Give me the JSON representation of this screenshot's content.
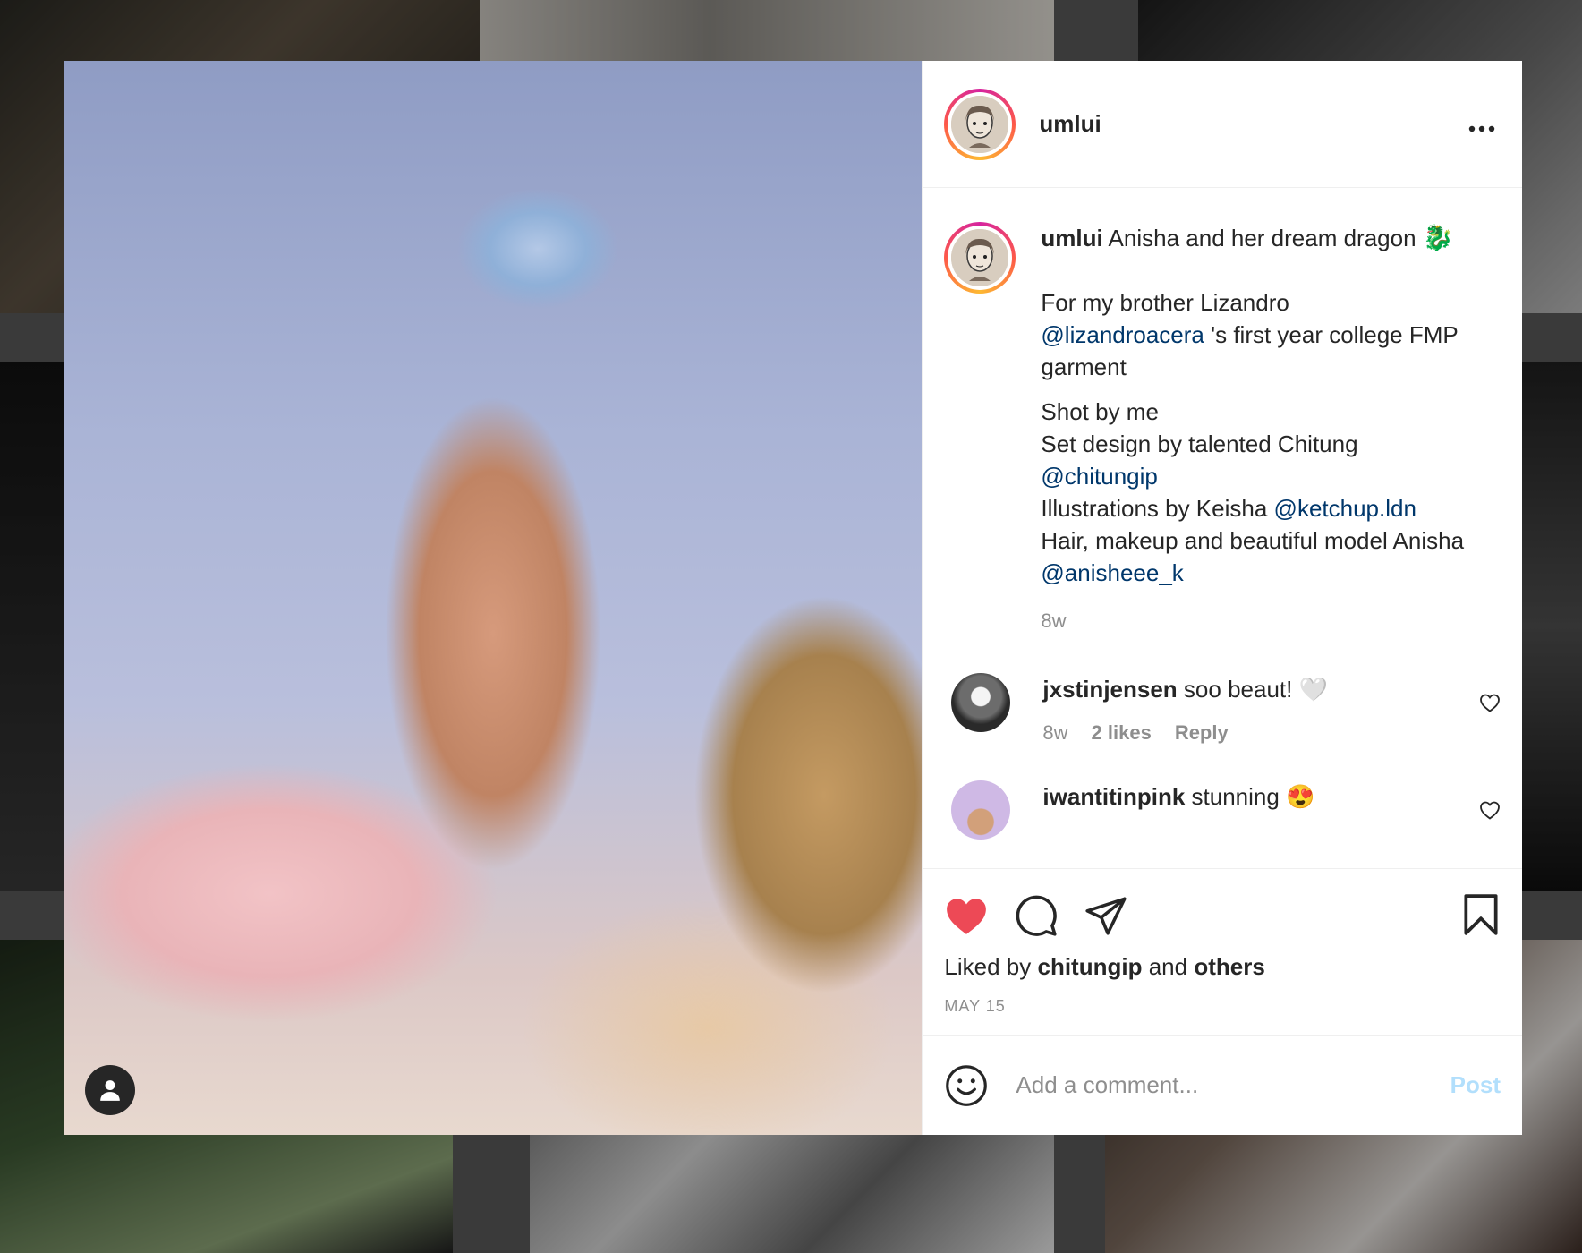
{
  "post": {
    "username": "umlui",
    "caption_title": "Anisha and her dream dragon",
    "caption_emoji": "🐉",
    "caption_line1": "For my brother Lizandro",
    "mention_lizandro": "@lizandroacera",
    "caption_line2": "'s first year college FMP garment",
    "caption_line3": "Shot by me",
    "caption_line4": "Set design by talented Chitung",
    "mention_chitung": "@chitungip",
    "caption_line5": "Illustrations by Keisha",
    "mention_keisha": "@ketchup.ldn",
    "caption_line6": "Hair, makeup and beautiful model Anisha",
    "mention_anisha": "@anisheee_k",
    "caption_age": "8w",
    "liked_prefix": "Liked by",
    "liked_user": "chitungip",
    "liked_and": "and",
    "liked_others": "others",
    "date": "MAY 15"
  },
  "comments": [
    {
      "user": "jxstinjensen",
      "text": "soo beaut!",
      "emoji": "🤍",
      "age": "8w",
      "likes": "2 likes",
      "reply": "Reply"
    },
    {
      "user": "iwantitinpink",
      "text": "stunning",
      "emoji": "😍"
    }
  ],
  "composer": {
    "placeholder": "Add a comment...",
    "post_label": "Post"
  },
  "colors": {
    "heart": "#ed4956",
    "link": "#00376b",
    "post_disabled": "#b2dffc"
  },
  "icons": [
    "user-icon",
    "more-icon",
    "heart-filled-icon",
    "comment-icon",
    "share-icon",
    "bookmark-icon",
    "emoji-icon",
    "heart-outline-icon"
  ]
}
